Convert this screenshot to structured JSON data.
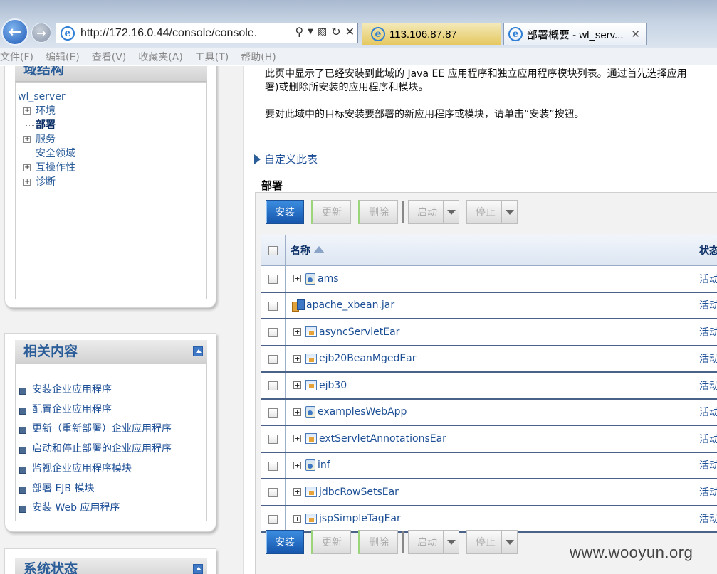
{
  "browser": {
    "url": "http://172.16.0.44/console/console.",
    "tabs": [
      {
        "label": "113.106.87.87"
      },
      {
        "label": "部署概要 - wl_serv...",
        "close": "✕"
      }
    ],
    "menu": [
      "文件(F)",
      "编辑(E)",
      "查看(V)",
      "收藏夹(A)",
      "工具(T)",
      "帮助(H)"
    ]
  },
  "domain_panel": {
    "title": "域结构",
    "root": "wl_server",
    "nodes": [
      {
        "label": "环境",
        "expandable": true
      },
      {
        "label": "部署",
        "expandable": false,
        "selected": true
      },
      {
        "label": "服务",
        "expandable": true
      },
      {
        "label": "安全领域",
        "expandable": false
      },
      {
        "label": "互操作性",
        "expandable": true
      },
      {
        "label": "诊断",
        "expandable": true
      }
    ]
  },
  "related_panel": {
    "title": "相关内容",
    "items": [
      "安装企业应用程序",
      "配置企业应用程序",
      "更新（重新部署）企业应用程序",
      "启动和停止部署的企业应用程序",
      "监视企业应用程序模块",
      "部署 EJB 模块",
      "安装 Web 应用程序"
    ]
  },
  "status_panel": {
    "title": "系统状态"
  },
  "content": {
    "intro_line1": "此页中显示了已经安装到此域的 Java EE 应用程序和独立应用程序模块列表。通过首先选择应用",
    "intro_line2": "署)或删除所安装的应用程序和模块。",
    "intro_line3": "要对此域中的目标安装要部署的新应用程序或模块，请单击“安装”按钮。",
    "customize": "自定义此表",
    "section": "部署",
    "buttons": {
      "install": "安装",
      "update": "更新",
      "delete": "删除",
      "start": "启动",
      "stop": "停止"
    },
    "columns": {
      "name": "名称",
      "state": "状态"
    },
    "rows": [
      {
        "name": "ams",
        "icon": "app",
        "state": "活动"
      },
      {
        "name": "apache_xbean.jar",
        "icon": "jar",
        "state": "活动"
      },
      {
        "name": "asyncServletEar",
        "icon": "ear",
        "state": "活动"
      },
      {
        "name": "ejb20BeanMgedEar",
        "icon": "ear",
        "state": "活动"
      },
      {
        "name": "ejb30",
        "icon": "ear",
        "state": "活动"
      },
      {
        "name": "examplesWebApp",
        "icon": "app",
        "state": "活动"
      },
      {
        "name": "extServletAnnotationsEar",
        "icon": "ear",
        "state": "活动"
      },
      {
        "name": "inf",
        "icon": "app",
        "state": "活动"
      },
      {
        "name": "jdbcRowSetsEar",
        "icon": "ear",
        "state": "活动"
      },
      {
        "name": "jspSimpleTagEar",
        "icon": "ear",
        "state": "活动"
      }
    ]
  },
  "watermark": "www.wooyun.org"
}
